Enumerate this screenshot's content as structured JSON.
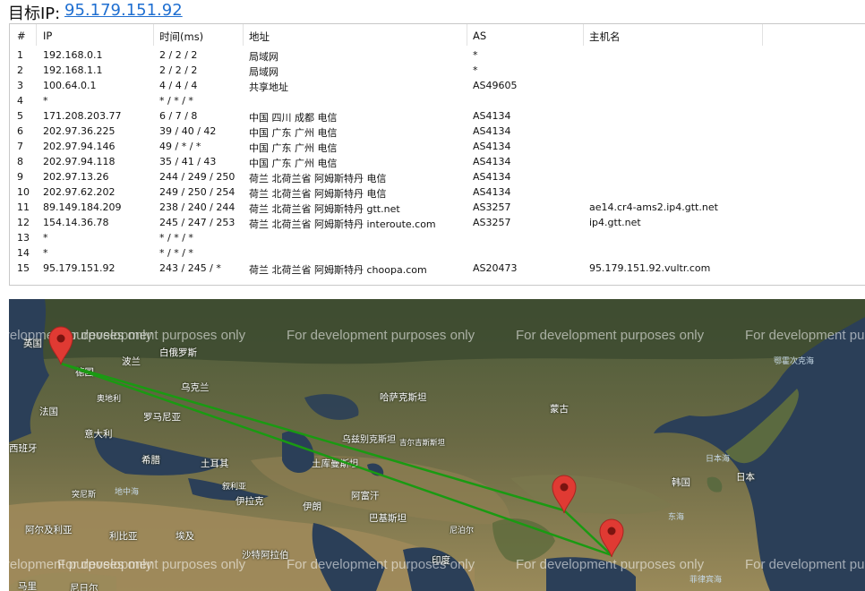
{
  "header": {
    "label": "目标IP:",
    "target_ip": "95.179.151.92"
  },
  "table": {
    "columns": [
      "#",
      "IP",
      "时间(ms)",
      "地址",
      "AS",
      "主机名"
    ],
    "rows": [
      [
        "1",
        "192.168.0.1",
        "2 / 2 / 2",
        "局域网",
        "*",
        ""
      ],
      [
        "2",
        "192.168.1.1",
        "2 / 2 / 2",
        "局域网",
        "*",
        ""
      ],
      [
        "3",
        "100.64.0.1",
        "4 / 4 / 4",
        "共享地址",
        "AS49605",
        ""
      ],
      [
        "4",
        "*",
        "* / * / *",
        "",
        "",
        ""
      ],
      [
        "5",
        "171.208.203.77",
        "6 / 7 / 8",
        "中国 四川 成都 电信",
        "AS4134",
        ""
      ],
      [
        "6",
        "202.97.36.225",
        "39 / 40 / 42",
        "中国 广东 广州 电信",
        "AS4134",
        ""
      ],
      [
        "7",
        "202.97.94.146",
        "49 / * / *",
        "中国 广东 广州 电信",
        "AS4134",
        ""
      ],
      [
        "8",
        "202.97.94.118",
        "35 / 41 / 43",
        "中国 广东 广州 电信",
        "AS4134",
        ""
      ],
      [
        "9",
        "202.97.13.26",
        "244 / 249 / 250",
        "荷兰 北荷兰省 阿姆斯特丹 电信",
        "AS4134",
        ""
      ],
      [
        "10",
        "202.97.62.202",
        "249 / 250 / 254",
        "荷兰 北荷兰省 阿姆斯特丹 电信",
        "AS4134",
        ""
      ],
      [
        "11",
        "89.149.184.209",
        "238 / 240 / 244",
        "荷兰 北荷兰省 阿姆斯特丹 gtt.net",
        "AS3257",
        "ae14.cr4-ams2.ip4.gtt.net"
      ],
      [
        "12",
        "154.14.36.78",
        "245 / 247 / 253",
        "荷兰 北荷兰省 阿姆斯特丹 interoute.com",
        "AS3257",
        "ip4.gtt.net"
      ],
      [
        "13",
        "*",
        "* / * / *",
        "",
        "",
        ""
      ],
      [
        "14",
        "*",
        "* / * / *",
        "",
        "",
        ""
      ],
      [
        "15",
        "95.179.151.92",
        "243 / 245 / *",
        "荷兰 北荷兰省 阿姆斯特丹 choopa.com",
        "AS20473",
        "95.179.151.92.vultr.com"
      ]
    ]
  },
  "map": {
    "watermark": "For development purposes only",
    "labels": [
      "英国",
      "白俄罗斯",
      "波兰",
      "德国",
      "乌克兰",
      "奥地利",
      "法国",
      "罗马尼亚",
      "意大利",
      "希腊",
      "西班牙",
      "土耳其",
      "地中海",
      "突尼斯",
      "叙利亚",
      "伊拉克",
      "阿尔及利亚",
      "利比亚",
      "埃及",
      "沙特阿拉伯",
      "马里",
      "尼日尔",
      "哈萨克斯坦",
      "乌兹别克斯坦",
      "吉尔吉斯斯坦",
      "土库曼斯坦",
      "伊朗",
      "阿富汗",
      "巴基斯坦",
      "尼泊尔",
      "印度",
      "蒙古",
      "韩国",
      "日本",
      "日本海",
      "东海",
      "鄂霍次克海",
      "菲律宾海"
    ],
    "route_color": "#1a9a12",
    "pin_color": "#e03a33"
  }
}
